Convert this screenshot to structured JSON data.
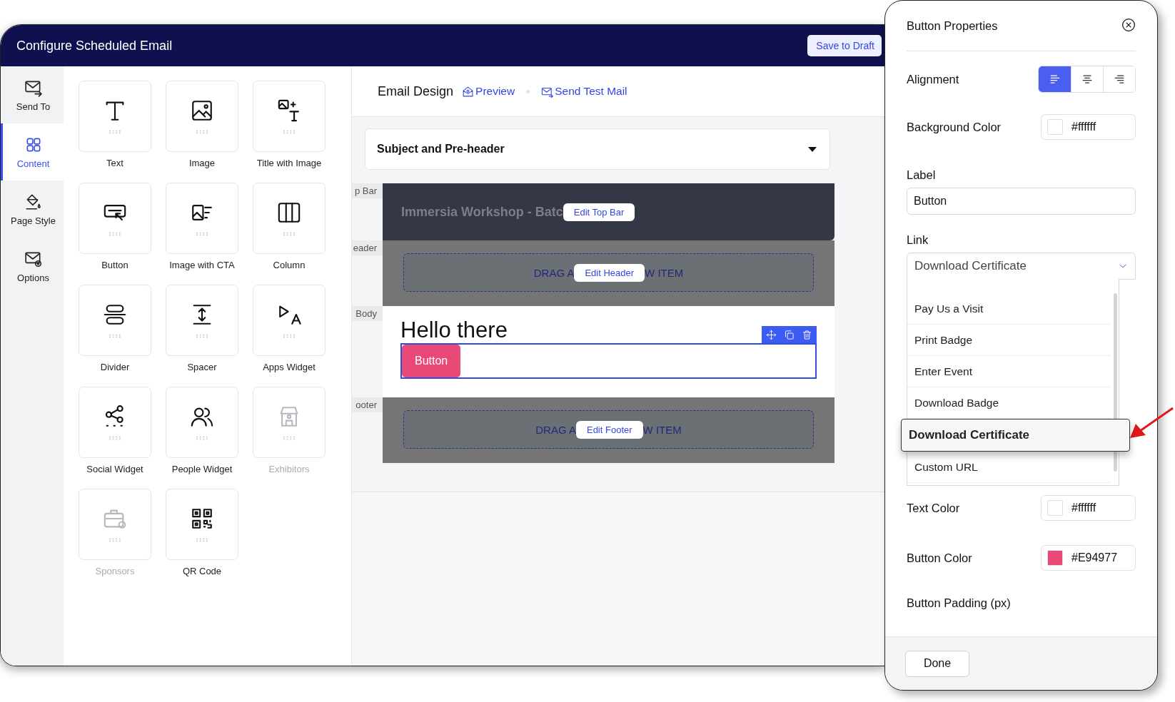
{
  "window": {
    "title": "Configure Scheduled Email",
    "save_button": "Save to Draft"
  },
  "nav": [
    {
      "label": "Send To",
      "selected": false
    },
    {
      "label": "Content",
      "selected": true
    },
    {
      "label": "Page Style",
      "selected": false
    },
    {
      "label": "Options",
      "selected": false
    }
  ],
  "widgets": [
    {
      "label": "Text",
      "disabled": false
    },
    {
      "label": "Image",
      "disabled": false
    },
    {
      "label": "Title with Image",
      "disabled": false
    },
    {
      "label": "Button",
      "disabled": false
    },
    {
      "label": "Image with CTA",
      "disabled": false
    },
    {
      "label": "Column",
      "disabled": false
    },
    {
      "label": "Divider",
      "disabled": false
    },
    {
      "label": "Spacer",
      "disabled": false
    },
    {
      "label": "Apps Widget",
      "disabled": false
    },
    {
      "label": "Social Widget",
      "disabled": false
    },
    {
      "label": "People Widget",
      "disabled": false
    },
    {
      "label": "Exhibitors",
      "disabled": true
    },
    {
      "label": "Sponsors",
      "disabled": true
    },
    {
      "label": "QR Code",
      "disabled": false
    }
  ],
  "editor": {
    "title": "Email Design",
    "links": [
      {
        "label": "Preview"
      },
      {
        "label": "Send Test Mail"
      }
    ],
    "subject": "Subject and Pre-header",
    "sections": [
      {
        "kind": "topbar",
        "side_label": "p Bar",
        "text": "Immersia Workshop - Batc",
        "edit": "Edit Top Bar"
      },
      {
        "kind": "dropzone",
        "side_label": "eader",
        "text_before": "DRAG A",
        "edit": "Edit Header",
        "text_after": "W ITEM"
      },
      {
        "kind": "body",
        "side_label": "Body",
        "heading": "Hello there",
        "button": "Button"
      },
      {
        "kind": "dropzone",
        "side_label": "ooter",
        "text_before": "DRAG A",
        "edit": "Edit Footer",
        "text_after": "W ITEM"
      }
    ]
  },
  "panel": {
    "title": "Button Properties",
    "alignment": {
      "label": "Alignment",
      "options": [
        {
          "selected": true
        },
        {
          "selected": false
        },
        {
          "selected": false
        }
      ]
    },
    "background_color": {
      "label": "Background Color",
      "value": "#ffffff"
    },
    "label_field": {
      "label": "Label",
      "value": "Button"
    },
    "link": {
      "label": "Link",
      "value": "Download Certificate",
      "expanded": true,
      "options": [
        {
          "label": "Pay Us a Visit",
          "selected": false
        },
        {
          "label": "Print Badge",
          "selected": false
        },
        {
          "label": "Enter Event",
          "selected": false
        },
        {
          "label": "Download Badge",
          "selected": false
        },
        {
          "label": "Download Certificate",
          "selected": true
        },
        {
          "label": "Custom URL",
          "selected": false
        }
      ]
    },
    "text_color": {
      "label": "Text Color",
      "value": "#ffffff"
    },
    "button_color": {
      "label": "Button Color",
      "value": "#E94977"
    },
    "padding_label": "Button Padding (px)",
    "done": "Done"
  }
}
